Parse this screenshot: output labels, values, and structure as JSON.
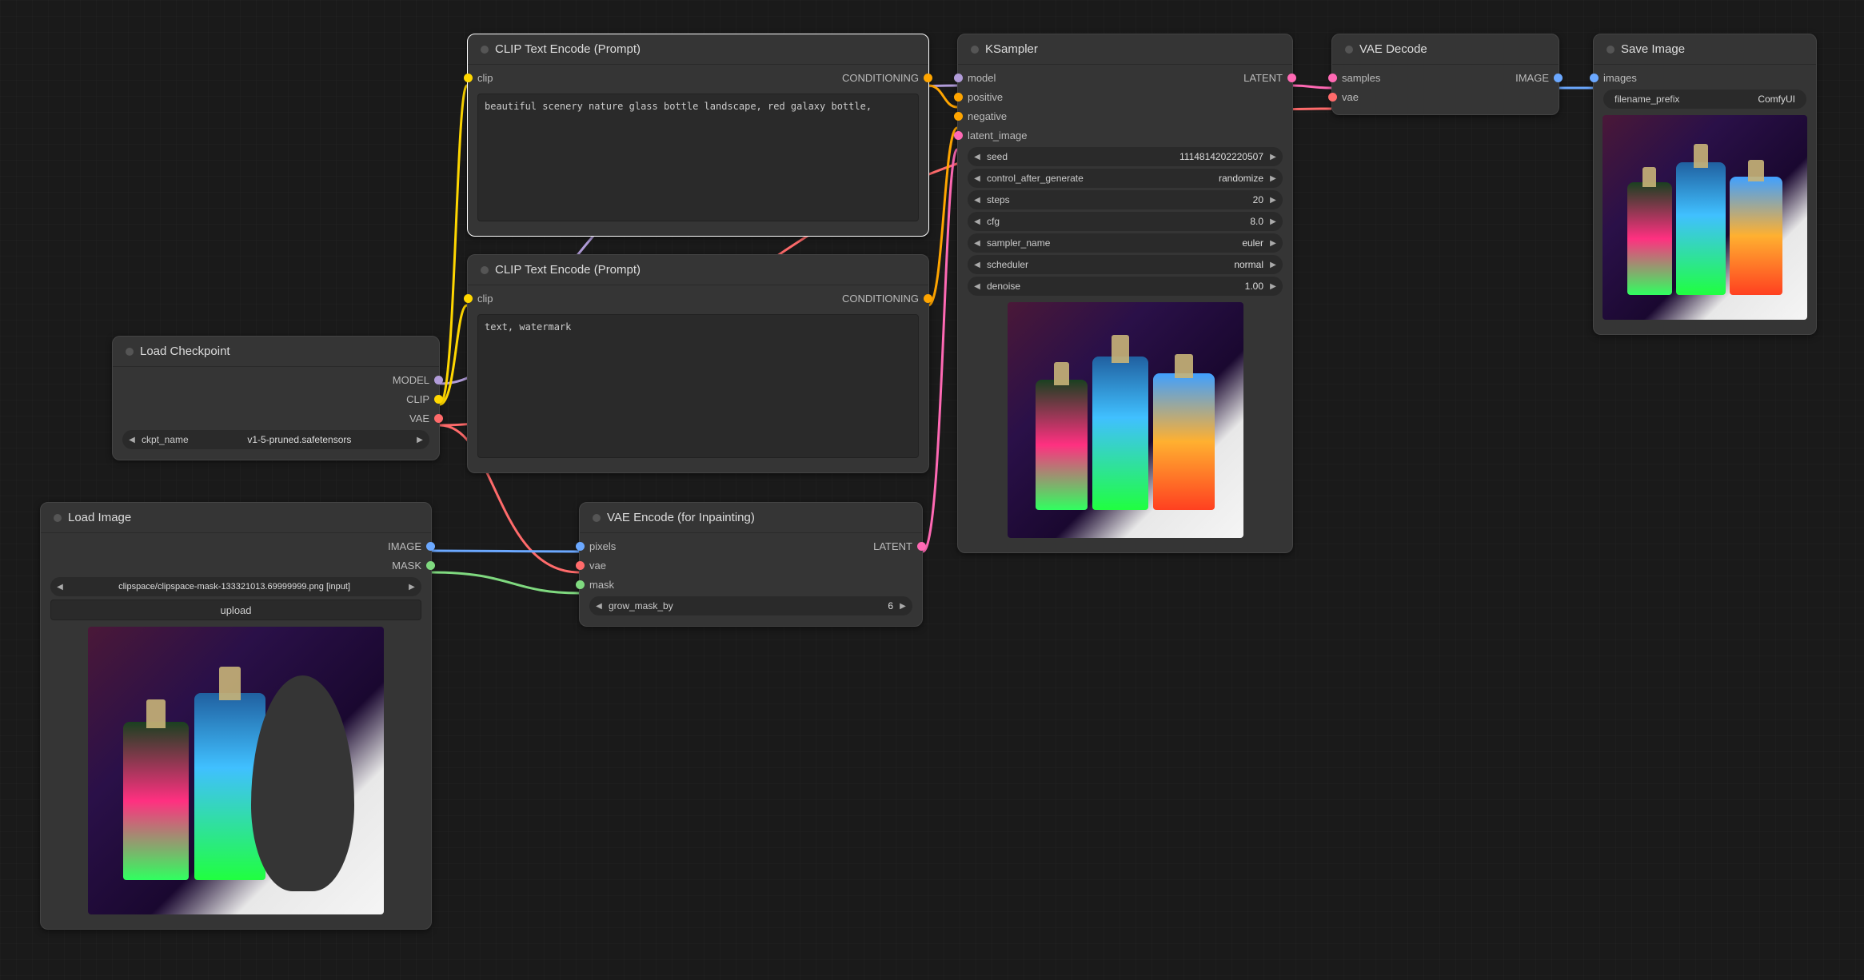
{
  "nodes": {
    "load_checkpoint": {
      "title": "Load Checkpoint",
      "outputs": {
        "model": "MODEL",
        "clip": "CLIP",
        "vae": "VAE"
      },
      "ckpt_name_label": "ckpt_name",
      "ckpt_name_value": "v1-5-pruned.safetensors"
    },
    "clip_pos": {
      "title": "CLIP Text Encode (Prompt)",
      "input_clip": "clip",
      "output": "CONDITIONING",
      "text": "beautiful scenery nature glass bottle landscape, red galaxy bottle,"
    },
    "clip_neg": {
      "title": "CLIP Text Encode (Prompt)",
      "input_clip": "clip",
      "output": "CONDITIONING",
      "text": "text, watermark"
    },
    "load_image": {
      "title": "Load Image",
      "outputs": {
        "image": "IMAGE",
        "mask": "MASK"
      },
      "image_label": "image",
      "image_value": "clipspace/clipspace-mask-133321013.69999999.png [input]",
      "upload_label": "upload"
    },
    "vae_encode": {
      "title": "VAE Encode (for Inpainting)",
      "inputs": {
        "pixels": "pixels",
        "vae": "vae",
        "mask": "mask"
      },
      "output": "LATENT",
      "grow_mask_label": "grow_mask_by",
      "grow_mask_value": "6"
    },
    "ksampler": {
      "title": "KSampler",
      "inputs": {
        "model": "model",
        "positive": "positive",
        "negative": "negative",
        "latent_image": "latent_image"
      },
      "output": "LATENT",
      "params": [
        {
          "label": "seed",
          "value": "1114814202220507"
        },
        {
          "label": "control_after_generate",
          "value": "randomize"
        },
        {
          "label": "steps",
          "value": "20"
        },
        {
          "label": "cfg",
          "value": "8.0"
        },
        {
          "label": "sampler_name",
          "value": "euler"
        },
        {
          "label": "scheduler",
          "value": "normal"
        },
        {
          "label": "denoise",
          "value": "1.00"
        }
      ]
    },
    "vae_decode": {
      "title": "VAE Decode",
      "inputs": {
        "samples": "samples",
        "vae": "vae"
      },
      "output": "IMAGE"
    },
    "save_image": {
      "title": "Save Image",
      "input": "images",
      "filename_label": "filename_prefix",
      "filename_value": "ComfyUI"
    }
  }
}
